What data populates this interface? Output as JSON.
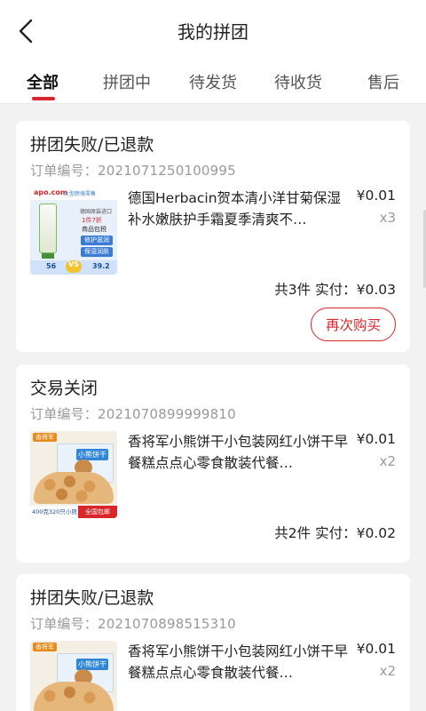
{
  "header": {
    "title": "我的拼团",
    "back_icon": "chevron-left-icon"
  },
  "tabs": [
    {
      "label": "全部",
      "active": true
    },
    {
      "label": "拼团中",
      "active": false
    },
    {
      "label": "待发货",
      "active": false
    },
    {
      "label": "待收货",
      "active": false
    },
    {
      "label": "售后",
      "active": false
    }
  ],
  "orders": [
    {
      "status": "拼团失败/已退款",
      "order_label": "订单编号：",
      "order_no": "2021071250100995",
      "product": {
        "name": "德国Herbacin贺本清小洋甘菊保湿补水嫩肤护手霜夏季清爽不…",
        "price": "¥0.01",
        "qty": "x3",
        "image_text": {
          "brand": "apo.com",
          "badge": "大型跨境零售",
          "promo": "1件7折",
          "tag1": "德国原装进口",
          "tag2": "商品包税",
          "feat1": "修护滋润",
          "feat2": "保湿润肤",
          "left_num": "56",
          "vs": "VS",
          "right_num": "39.2"
        }
      },
      "total_count": "共3件",
      "paid_label": "实付：",
      "paid": "¥0.03",
      "action": "再次购买"
    },
    {
      "status": "交易关闭",
      "order_label": "订单编号：",
      "order_no": "2021070899999810",
      "product": {
        "name": "香将军小熊饼干小包装网红小饼干早餐糕点点心零食散装代餐…",
        "price": "¥0.01",
        "qty": "x2",
        "image_text": {
          "brand": "香将军",
          "box_label": "小熊饼干",
          "bottom_left": "400克320只小熊",
          "bottom_right": "全国包邮"
        }
      },
      "total_count": "共2件",
      "paid_label": "实付：",
      "paid": "¥0.02"
    },
    {
      "status": "拼团失败/已退款",
      "order_label": "订单编号：",
      "order_no": "2021070898515310",
      "product": {
        "name": "香将军小熊饼干小包装网红小饼干早餐糕点点心零食散装代餐…",
        "price": "¥0.01",
        "qty": "x2",
        "image_text": {
          "brand": "香将军",
          "box_label": "小熊饼干"
        }
      }
    }
  ],
  "colors": {
    "accent": "#d8262a",
    "background": "#f2f2f2",
    "muted_text": "#999999"
  }
}
